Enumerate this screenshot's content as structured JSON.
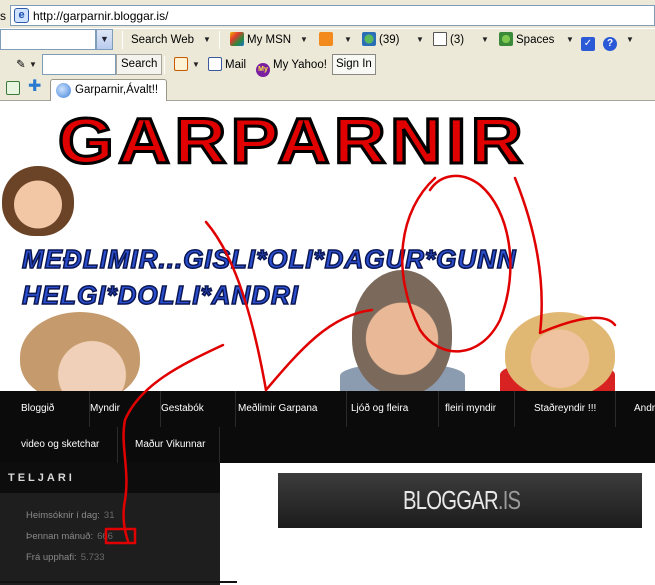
{
  "browser": {
    "address_prefix": "s",
    "address_url": "http://garparnir.bloggar.is/",
    "msn_toolbar": {
      "search_web_label": "Search Web",
      "my_msn_label": "My MSN",
      "messenger_count": "(39)",
      "mail_count": "(3)",
      "spaces_label": "Spaces"
    },
    "search_toolbar": {
      "search_button": "Search",
      "mail_label": "Mail",
      "my_yahoo_label": "My Yahoo!",
      "sign_in_label": "Sign In"
    },
    "tab_title": "Garparnir,Ávalt!!"
  },
  "site": {
    "title": "GARPARNIR",
    "members_line_1": "MEÐLIMIR...GISLI*OLI*DAGUR*GUNN",
    "members_line_2": "HELGI*DOLLI*ANDRI",
    "nav_row_1": [
      "Bloggið",
      "Myndir",
      "Gestabók",
      "Meðlimir Garpana",
      "Ljóð og fleira",
      "fleiri myndir",
      "Staðreyndir !!!",
      "Andr"
    ],
    "nav_row_2": [
      "video og sketchar",
      "Maður Vikunnar"
    ],
    "counter": {
      "heading": "TELJARI",
      "visits_today_label": "Heimsóknir í dag:",
      "visits_today_value": "31",
      "this_month_label": "Þennan mánuð:",
      "this_month_value": "666",
      "since_start_label": "Frá upphafi:",
      "since_start_value": "5.733"
    },
    "bloggar_logo": "BLOGGAR",
    "bloggar_logo_suffix": ".IS"
  },
  "colors": {
    "annotation": "#e00000",
    "title_red": "#e00000",
    "nav_bg": "#0b0b0b"
  }
}
